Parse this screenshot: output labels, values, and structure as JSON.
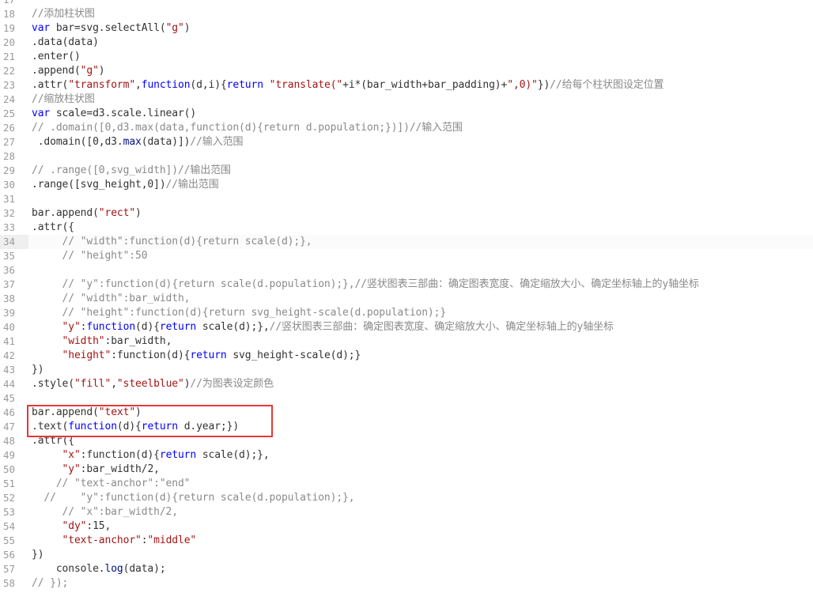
{
  "colors": {
    "keyword": "#0000ff",
    "string": "#a31515",
    "comment": "#8a8a8a",
    "highlight_border": "#e53935",
    "active_line": "#efefef"
  },
  "editor": {
    "active_line": 34,
    "highlighted_lines": [
      46,
      47
    ],
    "lines": [
      {
        "n": "17",
        "tokens": []
      },
      {
        "n": "18",
        "tokens": [
          [
            "comment",
            "//添加柱状图"
          ]
        ]
      },
      {
        "n": "19",
        "tokens": [
          [
            "keyword",
            "var"
          ],
          [
            "plain",
            " bar=svg.selectAll("
          ],
          [
            "string",
            "\"g\""
          ],
          [
            "plain",
            ")"
          ]
        ]
      },
      {
        "n": "20",
        "tokens": [
          [
            "plain",
            ".data(data)"
          ]
        ]
      },
      {
        "n": "21",
        "tokens": [
          [
            "plain",
            ".enter()"
          ]
        ]
      },
      {
        "n": "22",
        "tokens": [
          [
            "plain",
            ".append("
          ],
          [
            "string",
            "\"g\""
          ],
          [
            "plain",
            ")"
          ]
        ]
      },
      {
        "n": "23",
        "tokens": [
          [
            "plain",
            ".attr("
          ],
          [
            "string",
            "\"transform\""
          ],
          [
            "plain",
            ","
          ],
          [
            "keyword",
            "function"
          ],
          [
            "plain",
            "(d,i){"
          ],
          [
            "keyword",
            "return"
          ],
          [
            "plain",
            " "
          ],
          [
            "string",
            "\"translate(\""
          ],
          [
            "plain",
            "+i*(bar_width+bar_padding)+"
          ],
          [
            "string",
            "\",0)\""
          ],
          [
            "plain",
            "})"
          ],
          [
            "comment",
            "//给每个柱状图设定位置"
          ]
        ]
      },
      {
        "n": "24",
        "tokens": [
          [
            "comment",
            "//缩放柱状图"
          ]
        ]
      },
      {
        "n": "25",
        "tokens": [
          [
            "keyword",
            "var"
          ],
          [
            "plain",
            " scale=d3.scale.linear()"
          ]
        ]
      },
      {
        "n": "26",
        "tokens": [
          [
            "comment",
            "// .domain([0,d3.max(data,function(d){return d.population;})])//输入范围"
          ]
        ]
      },
      {
        "n": "27",
        "tokens": [
          [
            "plain",
            " .domain([0,d3."
          ],
          [
            "builtin",
            "max"
          ],
          [
            "plain",
            "(data)])"
          ],
          [
            "comment",
            "//输入范围"
          ]
        ]
      },
      {
        "n": "28",
        "tokens": []
      },
      {
        "n": "29",
        "tokens": [
          [
            "comment",
            "// .range([0,svg_width])//输出范围"
          ]
        ]
      },
      {
        "n": "30",
        "tokens": [
          [
            "plain",
            ".range([svg_height,0])"
          ],
          [
            "comment",
            "//输出范围"
          ]
        ]
      },
      {
        "n": "31",
        "tokens": []
      },
      {
        "n": "32",
        "tokens": [
          [
            "plain",
            "bar.append("
          ],
          [
            "string",
            "\"rect\""
          ],
          [
            "plain",
            ")"
          ]
        ]
      },
      {
        "n": "33",
        "tokens": [
          [
            "plain",
            ".attr({"
          ]
        ]
      },
      {
        "n": "34",
        "tokens": [
          [
            "comment",
            "     // \"width\":function(d){return scale(d);},"
          ]
        ]
      },
      {
        "n": "35",
        "tokens": [
          [
            "comment",
            "     // \"height\":50"
          ]
        ]
      },
      {
        "n": "36",
        "tokens": []
      },
      {
        "n": "37",
        "tokens": [
          [
            "comment",
            "     // \"y\":function(d){return scale(d.population);},//竖状图表三部曲：确定图表宽度、确定缩放大小、确定坐标轴上的y轴坐标"
          ]
        ]
      },
      {
        "n": "38",
        "tokens": [
          [
            "comment",
            "     // \"width\":bar_width,"
          ]
        ]
      },
      {
        "n": "39",
        "tokens": [
          [
            "comment",
            "     // \"height\":function(d){return svg_height-scale(d.population);}"
          ]
        ]
      },
      {
        "n": "40",
        "tokens": [
          [
            "plain",
            "     "
          ],
          [
            "key",
            "\"y\""
          ],
          [
            "plain",
            ":"
          ],
          [
            "keyword",
            "function"
          ],
          [
            "plain",
            "(d){"
          ],
          [
            "keyword",
            "return"
          ],
          [
            "plain",
            " scale(d);},"
          ],
          [
            "comment",
            "//竖状图表三部曲：确定图表宽度、确定缩放大小、确定坐标轴上的y轴坐标"
          ]
        ]
      },
      {
        "n": "41",
        "tokens": [
          [
            "plain",
            "     "
          ],
          [
            "key",
            "\"width\""
          ],
          [
            "plain",
            ":bar_width,"
          ]
        ]
      },
      {
        "n": "42",
        "tokens": [
          [
            "plain",
            "     "
          ],
          [
            "key",
            "\"height\""
          ],
          [
            "plain",
            ":function(d){"
          ],
          [
            "keyword",
            "return"
          ],
          [
            "plain",
            " svg_height-scale(d);}"
          ]
        ]
      },
      {
        "n": "43",
        "tokens": [
          [
            "plain",
            "})"
          ]
        ]
      },
      {
        "n": "44",
        "tokens": [
          [
            "plain",
            ".style("
          ],
          [
            "string",
            "\"fill\""
          ],
          [
            "plain",
            ","
          ],
          [
            "string",
            "\"steelblue\""
          ],
          [
            "plain",
            ")"
          ],
          [
            "comment",
            "//为图表设定颜色"
          ]
        ]
      },
      {
        "n": "45",
        "tokens": []
      },
      {
        "n": "46",
        "tokens": [
          [
            "plain",
            "bar.append("
          ],
          [
            "string",
            "\"text\""
          ],
          [
            "plain",
            ")"
          ]
        ]
      },
      {
        "n": "47",
        "tokens": [
          [
            "plain",
            ".text("
          ],
          [
            "keyword",
            "function"
          ],
          [
            "plain",
            "(d){"
          ],
          [
            "keyword",
            "return"
          ],
          [
            "plain",
            " d.year;})"
          ]
        ]
      },
      {
        "n": "48",
        "tokens": [
          [
            "plain",
            ".attr({"
          ]
        ]
      },
      {
        "n": "49",
        "tokens": [
          [
            "plain",
            "     "
          ],
          [
            "key",
            "\"x\""
          ],
          [
            "plain",
            ":function(d){"
          ],
          [
            "keyword",
            "return"
          ],
          [
            "plain",
            " scale(d);},"
          ]
        ]
      },
      {
        "n": "50",
        "tokens": [
          [
            "plain",
            "     "
          ],
          [
            "key",
            "\"y\""
          ],
          [
            "plain",
            ":bar_width/2,"
          ]
        ]
      },
      {
        "n": "51",
        "tokens": [
          [
            "comment",
            "    // \"text-anchor\":\"end\""
          ]
        ]
      },
      {
        "n": "52",
        "tokens": [
          [
            "comment",
            "  //    \"y\":function(d){return scale(d.population);},"
          ]
        ]
      },
      {
        "n": "53",
        "tokens": [
          [
            "comment",
            "     // \"x\":bar_width/2,"
          ]
        ]
      },
      {
        "n": "54",
        "tokens": [
          [
            "plain",
            "     "
          ],
          [
            "key",
            "\"dy\""
          ],
          [
            "plain",
            ":15,"
          ]
        ]
      },
      {
        "n": "55",
        "tokens": [
          [
            "plain",
            "     "
          ],
          [
            "key",
            "\"text-anchor\""
          ],
          [
            "plain",
            ":"
          ],
          [
            "string",
            "\"middle\""
          ]
        ]
      },
      {
        "n": "56",
        "tokens": [
          [
            "plain",
            "})"
          ]
        ]
      },
      {
        "n": "57",
        "tokens": [
          [
            "plain",
            "    console."
          ],
          [
            "builtin",
            "log"
          ],
          [
            "plain",
            "(data);"
          ]
        ]
      },
      {
        "n": "58",
        "tokens": [
          [
            "comment",
            "// });"
          ]
        ]
      }
    ]
  }
}
